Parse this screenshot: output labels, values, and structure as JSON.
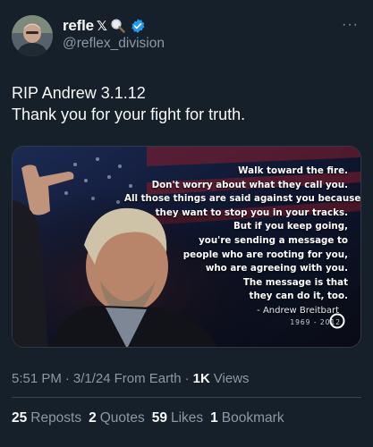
{
  "author": {
    "display_name": "refle",
    "x_suffix": "𝕏",
    "handle": "@reflex_division",
    "more_label": "···"
  },
  "tweet": {
    "lines": [
      "RIP Andrew 3.1.12",
      "Thank you for your fight for truth."
    ]
  },
  "media": {
    "quote_lines": [
      "Walk toward the fire.",
      "Don't worry about what they call you.",
      "All those things are said against you because",
      "they want to stop you in your tracks.",
      "But if you keep going,",
      "you're sending a message to",
      "people who are rooting for you,",
      "who are agreeing with you.",
      "The message is that",
      "they can do it, too."
    ],
    "attribution": "- Andrew Breitbart",
    "years": "1969 - 2012"
  },
  "meta": {
    "time": "5:51 PM",
    "sep1": "·",
    "date": "3/1/24",
    "source": "From Earth",
    "sep2": "·",
    "views_count": "1K",
    "views_label": "Views"
  },
  "stats": {
    "reposts_count": "25",
    "reposts_label": "Reposts",
    "quotes_count": "2",
    "quotes_label": "Quotes",
    "likes_count": "59",
    "likes_label": "Likes",
    "bookmarks_count": "1",
    "bookmarks_label": "Bookmark"
  },
  "colors": {
    "background": "#15202b",
    "text_primary": "#f7f9f9",
    "text_secondary": "#8b98a5",
    "verified_blue": "#1d9bf0",
    "divider": "#38444d"
  }
}
